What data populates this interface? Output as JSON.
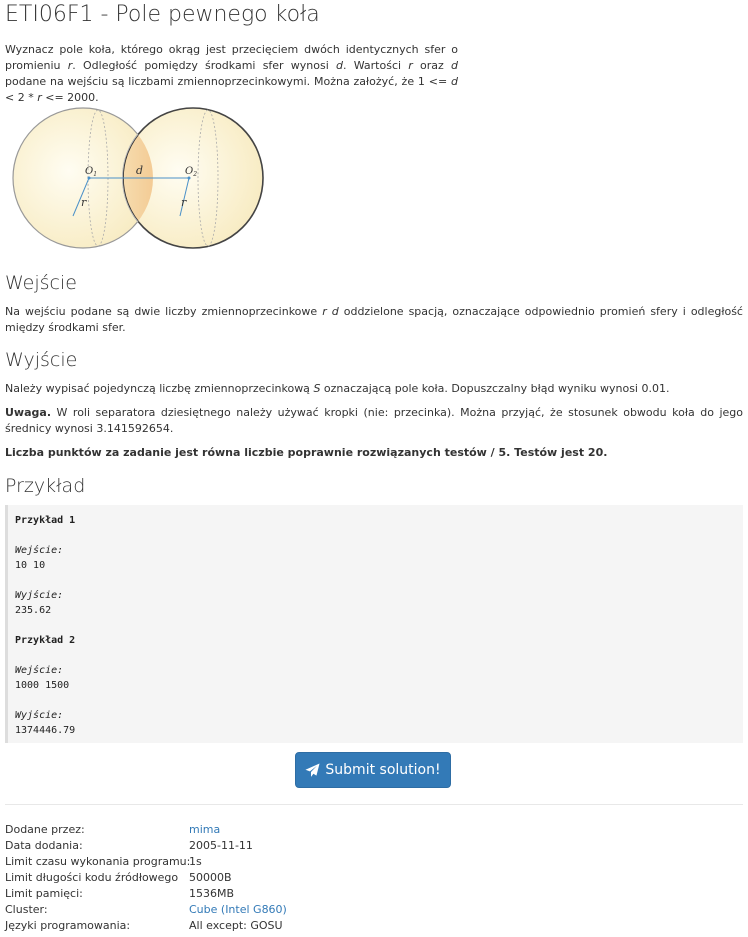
{
  "problem": {
    "title": "ETI06F1 - Pole pewnego koła",
    "intro": {
      "p1": "Wyznacz pole koła, którego okrąg jest przecięciem dwóch identycznych sfer o promieniu ",
      "r": "r",
      "p2": ". Odległość pomiędzy środkami sfer wynosi ",
      "d": "d",
      "p3": ". Wartości ",
      "r2": "r",
      "p4": " oraz ",
      "d2": "d",
      "p5": " podane na wejściu są liczbami zmiennoprzecinkowymi. Można założyć, że 1 <= ",
      "d3": "d",
      "p6": " < 2 * ",
      "r3": "r",
      "p7": " <= 2000."
    },
    "figure_labels": {
      "o1": "O",
      "o1_sub": "1",
      "o2": "O",
      "o2_sub": "2",
      "d": "d",
      "r_left": "r",
      "r_right": "r"
    }
  },
  "input_section": {
    "heading": "Wejście",
    "t1": "Na wejściu podane są dwie liczby zmiennoprzecinkowe ",
    "vars": "r d",
    "t2": " oddzielone spacją, oznaczające odpowiednio promień sfery i odległość między środkami sfer."
  },
  "output_section": {
    "heading": "Wyjście",
    "t1": "Należy wypisać pojedynczą liczbę zmiennoprzecinkową ",
    "var": "S",
    "t2": " oznaczającą pole koła. Dopuszczalny błąd wyniku wynosi 0.01.",
    "note_label": "Uwaga.",
    "note_text": " W roli separatora dziesiętnego należy używać kropki (nie: przecinka). Można przyjąć, że stosunek obwodu koła do jego średnicy wynosi 3.141592654.",
    "points": "Liczba punktów za zadanie jest równa liczbie poprawnie rozwiązanych testów / 5. Testów jest 20."
  },
  "example_section": {
    "heading": "Przykład",
    "ex1_title": "Przykład 1",
    "ex1_in_label": "Wejście:",
    "ex1_in": "10 10",
    "ex1_out_label": "Wyjście:",
    "ex1_out": "235.62",
    "ex2_title": "Przykład 2",
    "ex2_in_label": "Wejście:",
    "ex2_in": "1000 1500",
    "ex2_out_label": "Wyjście:",
    "ex2_out": "1374446.79"
  },
  "submit": {
    "label": "Submit solution!",
    "icon": "paper-plane-icon"
  },
  "meta": {
    "added_by_label": "Dodane przez:",
    "added_by": "mima",
    "date_label": "Data dodania:",
    "date": "2005-11-11",
    "time_label": "Limit czasu wykonania programu:",
    "time": "1s",
    "code_label": "Limit długości kodu źródłowego",
    "code": "50000B",
    "mem_label": "Limit pamięci:",
    "mem": "1536MB",
    "cluster_label": "Cluster:",
    "cluster": "Cube (Intel G860)",
    "langs_label": "Języki programowania:",
    "langs": "All except: GOSU"
  },
  "colors": {
    "link": "#337ab7",
    "button": "#337ab7",
    "sphere_fill": "#fdf6dc",
    "lens_fill": "#f3c98f"
  }
}
